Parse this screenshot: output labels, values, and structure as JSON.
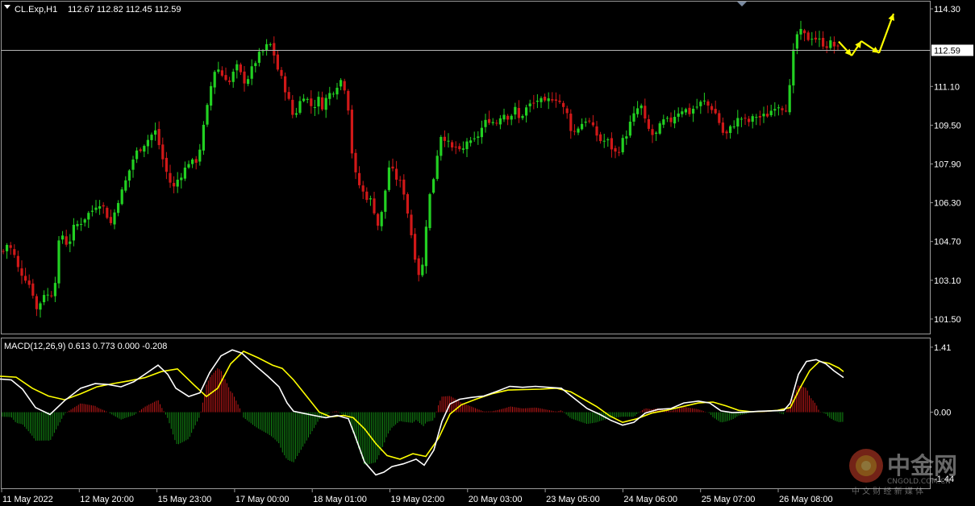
{
  "header": {
    "menu_icon": "triangle-down-icon",
    "symbol": "CL.Exp,H1",
    "ohlc": "112.67 112.82 112.45 112.59"
  },
  "macd_header": "MACD(12,26,9) 0.613 0.773 0.000 -0.208",
  "price_axis": {
    "ticks": [
      "114.30",
      "112.59",
      "111.10",
      "109.50",
      "107.90",
      "106.30",
      "104.70",
      "103.10",
      "101.50"
    ],
    "tick_values": [
      114.3,
      112.59,
      111.1,
      109.5,
      107.9,
      106.3,
      104.7,
      103.1,
      101.5
    ],
    "current": "112.59",
    "range": [
      100.9,
      114.6
    ]
  },
  "macd_axis": {
    "ticks": [
      "1.41",
      "0.00",
      "-1.44"
    ],
    "tick_values": [
      1.41,
      0.0,
      -1.44
    ],
    "range": [
      -1.65,
      1.6
    ]
  },
  "time_axis": [
    "11 May 2022",
    "12 May 20:00",
    "15 May 23:00",
    "17 May 00:00",
    "18 May 01:00",
    "19 May 02:00",
    "20 May 03:00",
    "23 May 05:00",
    "24 May 06:00",
    "25 May 07:00",
    "26 May 08:00"
  ],
  "colors": {
    "bull": "#22d022",
    "bear": "#d01818",
    "macd_line": "#ffffff",
    "signal_line": "#ffff00",
    "hist_pos": "#c01818",
    "hist_neg": "#138a13",
    "arrow": "#ffff00",
    "background": "#000000"
  },
  "watermark": {
    "logo_icon": "cngold-logo-icon",
    "name": "中金网",
    "domain": "CNGOLD.COM.CN",
    "tagline": "中 文 财 经 新 媒 体"
  },
  "chart_data": {
    "type": "candlestick",
    "price_path": [
      [
        0,
        104.0
      ],
      [
        8,
        104.6
      ],
      [
        16,
        104.3
      ],
      [
        22,
        103.6
      ],
      [
        32,
        103.2
      ],
      [
        40,
        102.7
      ],
      [
        46,
        101.8
      ],
      [
        54,
        102.6
      ],
      [
        62,
        102.4
      ],
      [
        68,
        103.0
      ],
      [
        72,
        104.5
      ],
      [
        78,
        105.0
      ],
      [
        84,
        104.5
      ],
      [
        92,
        105.3
      ],
      [
        100,
        105.5
      ],
      [
        108,
        105.8
      ],
      [
        115,
        106.0
      ],
      [
        122,
        106.4
      ],
      [
        130,
        106.0
      ],
      [
        138,
        105.4
      ],
      [
        146,
        106.4
      ],
      [
        152,
        106.8
      ],
      [
        160,
        107.6
      ],
      [
        166,
        108.2
      ],
      [
        172,
        108.5
      ],
      [
        180,
        108.8
      ],
      [
        186,
        109.0
      ],
      [
        192,
        109.3
      ],
      [
        198,
        108.6
      ],
      [
        204,
        107.8
      ],
      [
        210,
        107.2
      ],
      [
        216,
        106.9
      ],
      [
        222,
        107.4
      ],
      [
        228,
        107.6
      ],
      [
        234,
        108.0
      ],
      [
        240,
        107.9
      ],
      [
        246,
        108.2
      ],
      [
        250,
        109.0
      ],
      [
        256,
        110.0
      ],
      [
        262,
        111.2
      ],
      [
        268,
        112.0
      ],
      [
        274,
        111.6
      ],
      [
        280,
        111.5
      ],
      [
        286,
        111.2
      ],
      [
        292,
        112.0
      ],
      [
        298,
        111.6
      ],
      [
        304,
        111.3
      ],
      [
        310,
        111.6
      ],
      [
        316,
        112.1
      ],
      [
        322,
        112.4
      ],
      [
        328,
        112.6
      ],
      [
        334,
        112.9
      ],
      [
        340,
        112.4
      ],
      [
        346,
        111.6
      ],
      [
        352,
        111.2
      ],
      [
        358,
        110.5
      ],
      [
        364,
        109.8
      ],
      [
        370,
        110.3
      ],
      [
        376,
        110.8
      ],
      [
        382,
        110.5
      ],
      [
        388,
        110.2
      ],
      [
        394,
        110.6
      ],
      [
        400,
        110.3
      ],
      [
        406,
        110.7
      ],
      [
        412,
        110.9
      ],
      [
        418,
        111.2
      ],
      [
        424,
        111.4
      ],
      [
        428,
        111.0
      ],
      [
        432,
        110.2
      ],
      [
        436,
        108.5
      ],
      [
        440,
        107.5
      ],
      [
        446,
        107.0
      ],
      [
        452,
        106.6
      ],
      [
        458,
        106.5
      ],
      [
        464,
        106.0
      ],
      [
        470,
        105.2
      ],
      [
        476,
        106.4
      ],
      [
        482,
        107.8
      ],
      [
        488,
        107.5
      ],
      [
        494,
        107.2
      ],
      [
        500,
        106.9
      ],
      [
        506,
        105.8
      ],
      [
        512,
        104.6
      ],
      [
        518,
        103.5
      ],
      [
        522,
        103.2
      ],
      [
        526,
        104.3
      ],
      [
        530,
        106.2
      ],
      [
        536,
        107.0
      ],
      [
        542,
        108.3
      ],
      [
        548,
        109.3
      ],
      [
        554,
        108.8
      ],
      [
        560,
        108.5
      ],
      [
        566,
        108.6
      ],
      [
        572,
        108.2
      ],
      [
        578,
        108.9
      ],
      [
        584,
        108.7
      ],
      [
        590,
        108.9
      ],
      [
        596,
        109.3
      ],
      [
        602,
        109.6
      ],
      [
        608,
        109.8
      ],
      [
        614,
        109.5
      ],
      [
        620,
        109.9
      ],
      [
        626,
        110.0
      ],
      [
        632,
        109.8
      ],
      [
        638,
        110.2
      ],
      [
        644,
        109.7
      ],
      [
        650,
        110.1
      ],
      [
        656,
        110.3
      ],
      [
        662,
        110.4
      ],
      [
        668,
        110.6
      ],
      [
        674,
        110.3
      ],
      [
        680,
        110.5
      ],
      [
        686,
        110.7
      ],
      [
        692,
        110.6
      ],
      [
        698,
        110.2
      ],
      [
        704,
        109.9
      ],
      [
        710,
        109.1
      ],
      [
        716,
        109.4
      ],
      [
        722,
        109.6
      ],
      [
        728,
        109.8
      ],
      [
        734,
        109.4
      ],
      [
        740,
        109.1
      ],
      [
        746,
        108.8
      ],
      [
        752,
        108.9
      ],
      [
        758,
        108.6
      ],
      [
        764,
        108.3
      ],
      [
        770,
        108.7
      ],
      [
        776,
        109.1
      ],
      [
        782,
        109.6
      ],
      [
        788,
        110.0
      ],
      [
        794,
        110.4
      ],
      [
        800,
        109.6
      ],
      [
        806,
        109.2
      ],
      [
        812,
        109.0
      ],
      [
        818,
        109.4
      ],
      [
        824,
        109.7
      ],
      [
        830,
        109.6
      ],
      [
        836,
        109.9
      ],
      [
        842,
        110.1
      ],
      [
        848,
        110.2
      ],
      [
        854,
        110.0
      ],
      [
        860,
        110.2
      ],
      [
        866,
        110.3
      ],
      [
        872,
        110.5
      ],
      [
        878,
        110.3
      ],
      [
        884,
        110.2
      ],
      [
        890,
        109.8
      ],
      [
        896,
        109.2
      ],
      [
        902,
        109.1
      ],
      [
        908,
        109.5
      ],
      [
        914,
        109.7
      ],
      [
        920,
        109.8
      ],
      [
        926,
        109.6
      ],
      [
        932,
        109.7
      ],
      [
        938,
        109.9
      ],
      [
        944,
        109.8
      ],
      [
        950,
        109.9
      ],
      [
        956,
        110.1
      ],
      [
        962,
        110.4
      ],
      [
        968,
        110.3
      ],
      [
        974,
        110.2
      ],
      [
        978,
        110.6
      ],
      [
        982,
        112.0
      ],
      [
        986,
        113.0
      ],
      [
        990,
        113.4
      ],
      [
        996,
        113.2
      ],
      [
        1002,
        113.1
      ],
      [
        1008,
        113.2
      ],
      [
        1014,
        113.0
      ],
      [
        1020,
        112.9
      ],
      [
        1026,
        112.8
      ],
      [
        1032,
        112.9
      ],
      [
        1036,
        112.7
      ],
      [
        1040,
        112.6
      ]
    ],
    "projection_arrows": [
      [
        1040,
        112.95
      ],
      [
        1056,
        112.37
      ],
      [
        1068,
        112.97
      ],
      [
        1090,
        112.48
      ],
      [
        1108,
        114.1
      ]
    ],
    "macd_line_path": [
      [
        0,
        0.72
      ],
      [
        14,
        0.7
      ],
      [
        28,
        0.5
      ],
      [
        44,
        0.1
      ],
      [
        62,
        -0.05
      ],
      [
        80,
        0.25
      ],
      [
        100,
        0.52
      ],
      [
        118,
        0.62
      ],
      [
        134,
        0.6
      ],
      [
        150,
        0.55
      ],
      [
        166,
        0.66
      ],
      [
        182,
        0.85
      ],
      [
        196,
        1.02
      ],
      [
        208,
        0.82
      ],
      [
        218,
        0.52
      ],
      [
        234,
        0.34
      ],
      [
        248,
        0.42
      ],
      [
        260,
        0.86
      ],
      [
        274,
        1.22
      ],
      [
        288,
        1.35
      ],
      [
        300,
        1.28
      ],
      [
        316,
        1.02
      ],
      [
        332,
        0.78
      ],
      [
        346,
        0.55
      ],
      [
        356,
        0.2
      ],
      [
        364,
        0.02
      ],
      [
        378,
        -0.03
      ],
      [
        392,
        -0.08
      ],
      [
        404,
        -0.12
      ],
      [
        418,
        -0.07
      ],
      [
        432,
        -0.14
      ],
      [
        440,
        -0.5
      ],
      [
        452,
        -1.08
      ],
      [
        466,
        -1.36
      ],
      [
        476,
        -1.3
      ],
      [
        486,
        -1.18
      ],
      [
        500,
        -1.12
      ],
      [
        516,
        -1.02
      ],
      [
        526,
        -1.15
      ],
      [
        538,
        -0.82
      ],
      [
        548,
        -0.2
      ],
      [
        558,
        0.18
      ],
      [
        570,
        0.28
      ],
      [
        584,
        0.32
      ],
      [
        600,
        0.35
      ],
      [
        616,
        0.45
      ],
      [
        632,
        0.56
      ],
      [
        648,
        0.54
      ],
      [
        664,
        0.56
      ],
      [
        680,
        0.54
      ],
      [
        696,
        0.52
      ],
      [
        712,
        0.3
      ],
      [
        728,
        0.08
      ],
      [
        744,
        -0.05
      ],
      [
        758,
        -0.18
      ],
      [
        772,
        -0.28
      ],
      [
        786,
        -0.22
      ],
      [
        800,
        -0.02
      ],
      [
        816,
        0.06
      ],
      [
        832,
        0.08
      ],
      [
        848,
        0.2
      ],
      [
        866,
        0.24
      ],
      [
        880,
        0.2
      ],
      [
        894,
        0.03
      ],
      [
        908,
        -0.01
      ],
      [
        924,
        0.0
      ],
      [
        940,
        0.02
      ],
      [
        956,
        0.03
      ],
      [
        972,
        0.04
      ],
      [
        980,
        0.2
      ],
      [
        990,
        0.82
      ],
      [
        1000,
        1.1
      ],
      [
        1012,
        1.14
      ],
      [
        1024,
        1.05
      ],
      [
        1034,
        0.9
      ],
      [
        1046,
        0.75
      ]
    ],
    "signal_line_path": [
      [
        0,
        0.78
      ],
      [
        20,
        0.76
      ],
      [
        40,
        0.52
      ],
      [
        60,
        0.35
      ],
      [
        80,
        0.27
      ],
      [
        100,
        0.4
      ],
      [
        120,
        0.55
      ],
      [
        140,
        0.62
      ],
      [
        160,
        0.68
      ],
      [
        180,
        0.75
      ],
      [
        200,
        0.88
      ],
      [
        220,
        0.94
      ],
      [
        240,
        0.6
      ],
      [
        256,
        0.34
      ],
      [
        270,
        0.52
      ],
      [
        286,
        1.05
      ],
      [
        302,
        1.32
      ],
      [
        320,
        1.18
      ],
      [
        338,
        1.02
      ],
      [
        350,
        0.95
      ],
      [
        364,
        0.7
      ],
      [
        380,
        0.35
      ],
      [
        396,
        0.0
      ],
      [
        410,
        -0.1
      ],
      [
        426,
        -0.07
      ],
      [
        438,
        -0.12
      ],
      [
        452,
        -0.36
      ],
      [
        466,
        -0.68
      ],
      [
        480,
        -0.94
      ],
      [
        496,
        -1.02
      ],
      [
        512,
        -0.9
      ],
      [
        528,
        -0.96
      ],
      [
        544,
        -0.56
      ],
      [
        558,
        -0.04
      ],
      [
        572,
        0.16
      ],
      [
        590,
        0.28
      ],
      [
        610,
        0.4
      ],
      [
        630,
        0.48
      ],
      [
        650,
        0.49
      ],
      [
        670,
        0.5
      ],
      [
        690,
        0.52
      ],
      [
        708,
        0.44
      ],
      [
        724,
        0.28
      ],
      [
        740,
        0.12
      ],
      [
        756,
        -0.08
      ],
      [
        772,
        -0.22
      ],
      [
        790,
        -0.14
      ],
      [
        808,
        -0.02
      ],
      [
        826,
        0.04
      ],
      [
        846,
        0.12
      ],
      [
        866,
        0.2
      ],
      [
        884,
        0.22
      ],
      [
        900,
        0.14
      ],
      [
        916,
        0.04
      ],
      [
        932,
        0.01
      ],
      [
        948,
        0.02
      ],
      [
        964,
        0.04
      ],
      [
        980,
        0.1
      ],
      [
        992,
        0.52
      ],
      [
        1004,
        0.9
      ],
      [
        1016,
        1.1
      ],
      [
        1028,
        1.06
      ],
      [
        1040,
        0.96
      ],
      [
        1046,
        0.88
      ]
    ],
    "histogram_hint": "macd minus signal, shown as thin red (positive) / green (negative) bars"
  }
}
